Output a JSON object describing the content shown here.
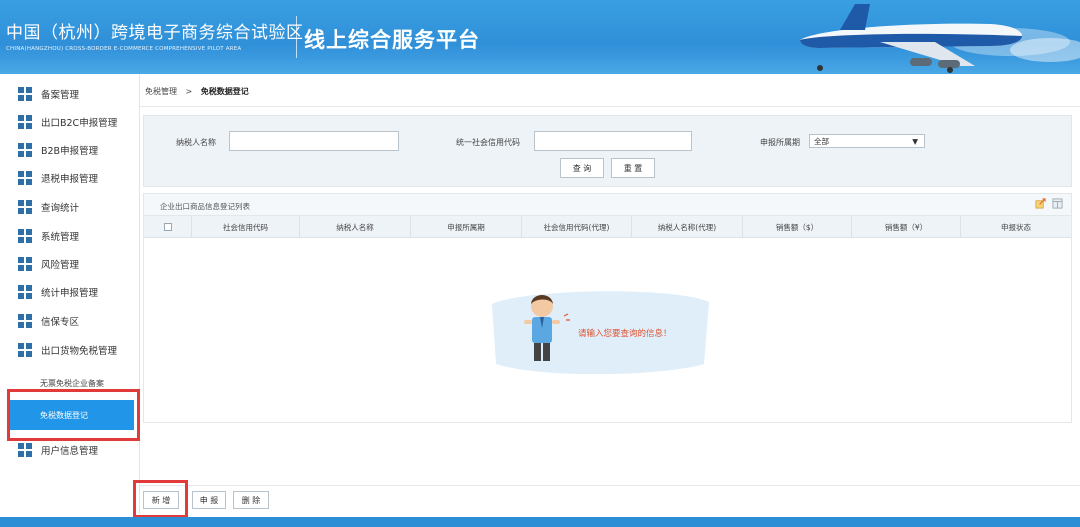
{
  "header": {
    "title": "中国（杭州）跨境电子商务综合试验区",
    "subtitle": "CHINA(HANGZHOU) CROSS-BORDER E-COMMERCE COMPREHENSIVE PILOT AREA",
    "platform": "线上综合服务平台"
  },
  "sidebar": {
    "items": [
      {
        "label": "备案管理"
      },
      {
        "label": "出口B2C申报管理"
      },
      {
        "label": "B2B申报管理"
      },
      {
        "label": "退税申报管理"
      },
      {
        "label": "查询统计"
      },
      {
        "label": "系统管理"
      },
      {
        "label": "风险管理"
      },
      {
        "label": "统计申报管理"
      },
      {
        "label": "信保专区"
      },
      {
        "label": "出口货物免税管理"
      }
    ],
    "sub_items": [
      {
        "label": "无票免税企业备案"
      },
      {
        "label": "免税数据登记"
      }
    ],
    "last_item": {
      "label": "用户信息管理"
    }
  },
  "breadcrumb": {
    "parent": "免税管理",
    "separator": ">",
    "current": "免税数据登记"
  },
  "search": {
    "taxpayer_name_label": "纳税人名称",
    "credit_code_label": "统一社会信用代码",
    "period_label": "申报所属期",
    "period_value": "全部",
    "query_button": "查 询",
    "reset_button": "重 置"
  },
  "table": {
    "title": "企业出口商品信息登记列表",
    "columns": [
      "社会信用代码",
      "纳税人名称",
      "申报所属期",
      "社会信用代码(代理)",
      "纳税人名称(代理)",
      "销售额（$）",
      "销售额（¥）",
      "申报状态"
    ],
    "empty_message": "请输入您要查询的信息！"
  },
  "actions": {
    "add": "新 增",
    "declare": "申 报",
    "delete": "删 除"
  },
  "colors": {
    "header_blue": "#2f8fd8",
    "active_blue": "#2196e8",
    "highlight_red": "#e03a3a",
    "empty_text": "#e0522e"
  }
}
